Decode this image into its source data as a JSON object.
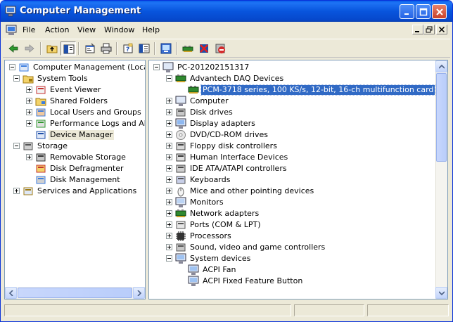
{
  "window": {
    "title": "Computer Management"
  },
  "menu": {
    "items": [
      "File",
      "Action",
      "View",
      "Window",
      "Help"
    ]
  },
  "toolbar": {
    "buttons": [
      "back-icon",
      "forward-icon",
      "up-folder-icon",
      "show-hide-tree-icon",
      "properties-icon",
      "print-icon",
      "help-icon",
      "export-list-icon",
      "scan-hardware-icon",
      "update-driver-icon",
      "disable-device-icon",
      "uninstall-device-icon"
    ]
  },
  "left_tree": {
    "items": [
      {
        "label": "Computer Management (Local)",
        "icon": "computer-management-icon"
      },
      {
        "label": "System Tools",
        "icon": "system-tools-icon"
      },
      {
        "label": "Event Viewer",
        "icon": "event-viewer-icon"
      },
      {
        "label": "Shared Folders",
        "icon": "shared-folders-icon"
      },
      {
        "label": "Local Users and Groups",
        "icon": "users-icon"
      },
      {
        "label": "Performance Logs and Alerts",
        "icon": "performance-icon"
      },
      {
        "label": "Device Manager",
        "icon": "device-manager-icon"
      },
      {
        "label": "Storage",
        "icon": "storage-icon"
      },
      {
        "label": "Removable Storage",
        "icon": "removable-storage-icon"
      },
      {
        "label": "Disk Defragmenter",
        "icon": "defrag-icon"
      },
      {
        "label": "Disk Management",
        "icon": "disk-management-icon"
      },
      {
        "label": "Services and Applications",
        "icon": "services-icon"
      }
    ]
  },
  "right_tree": {
    "items": [
      {
        "label": "PC-201202151317",
        "icon": "computer-icon"
      },
      {
        "label": "Advantech DAQ Devices",
        "icon": "daq-board-icon"
      },
      {
        "label": "PCM-3718 series, 100 KS/s, 12-bit, 16-ch multifunction card",
        "icon": "daq-board-icon"
      },
      {
        "label": "Computer",
        "icon": "computer-icon"
      },
      {
        "label": "Disk drives",
        "icon": "disk-drive-icon"
      },
      {
        "label": "Display adapters",
        "icon": "display-adapter-icon"
      },
      {
        "label": "DVD/CD-ROM drives",
        "icon": "cdrom-icon"
      },
      {
        "label": "Floppy disk controllers",
        "icon": "floppy-controller-icon"
      },
      {
        "label": "Human Interface Devices",
        "icon": "hid-icon"
      },
      {
        "label": "IDE ATA/ATAPI controllers",
        "icon": "ide-controller-icon"
      },
      {
        "label": "Keyboards",
        "icon": "keyboard-icon"
      },
      {
        "label": "Mice and other pointing devices",
        "icon": "mouse-icon"
      },
      {
        "label": "Monitors",
        "icon": "monitor-icon"
      },
      {
        "label": "Network adapters",
        "icon": "network-adapter-icon"
      },
      {
        "label": "Ports (COM & LPT)",
        "icon": "port-icon"
      },
      {
        "label": "Processors",
        "icon": "processor-icon"
      },
      {
        "label": "Sound, video and game controllers",
        "icon": "sound-icon"
      },
      {
        "label": "System devices",
        "icon": "system-device-icon"
      },
      {
        "label": "ACPI Fan",
        "icon": "system-device-icon"
      },
      {
        "label": "ACPI Fixed Feature Button",
        "icon": "system-device-icon"
      }
    ]
  },
  "colors": {
    "title_bar": "#0855dd",
    "selection": "#316ac5",
    "face": "#ece9d8"
  }
}
